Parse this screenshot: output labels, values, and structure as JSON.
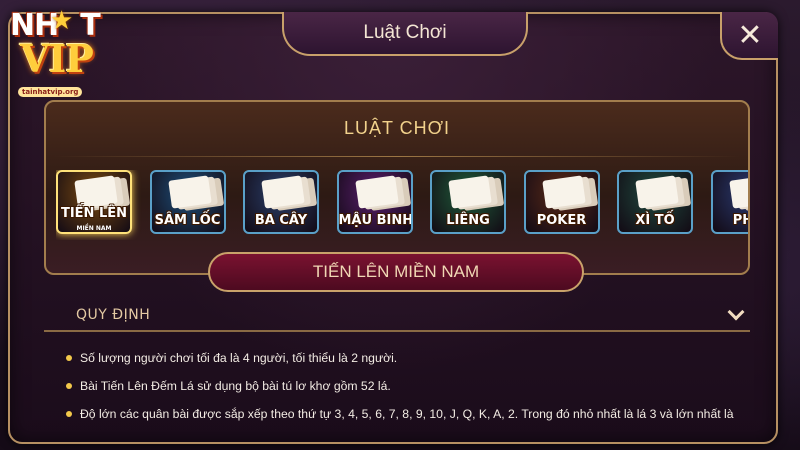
{
  "logo": {
    "line1": "NH",
    "star": "★",
    "line1_end": "T",
    "line2": "VIP",
    "site": "tainhatvip.org"
  },
  "dialog": {
    "title": "Luật Chơi",
    "close_label": "✕"
  },
  "panel": {
    "title": "LUẬT CHƠI"
  },
  "games": [
    {
      "label": "TIẾN LÊN",
      "sub": "MIỀN NAM",
      "bg": "#7a4a10",
      "active": true
    },
    {
      "label": "SÂM LỐC",
      "sub": "",
      "bg": "#1e4f7a",
      "active": false
    },
    {
      "label": "BA CÂY",
      "sub": "",
      "bg": "#2a3f6a",
      "active": false
    },
    {
      "label": "MẬU BINH",
      "sub": "",
      "bg": "#5a1e6e",
      "active": false
    },
    {
      "label": "LIÊNG",
      "sub": "",
      "bg": "#1f5c3a",
      "active": false
    },
    {
      "label": "POKER",
      "sub": "",
      "bg": "#5a2a18",
      "active": false
    },
    {
      "label": "XÌ TỐ",
      "sub": "",
      "bg": "#1f4a3e",
      "active": false
    },
    {
      "label": "PHỎ",
      "sub": "",
      "bg": "#2a3a70",
      "active": false
    }
  ],
  "selected_game": "TIẾN LÊN MIỀN NAM",
  "section": {
    "title": "QUY ĐỊNH"
  },
  "rules": [
    "Số lượng người chơi tối đa là 4 người, tối thiểu là 2 người.",
    "Bài Tiến Lên Đếm Lá sử dụng bộ bài tú lơ khơ gồm 52 lá.",
    "Độ lớn các quân bài được sắp xếp theo thứ tự 3, 4, 5, 6, 7, 8, 9, 10, J, Q, K, A, 2. Trong đó nhỏ nhất là lá 3 và lớn nhất là"
  ],
  "colors": {
    "gold_border": "#c8a06a",
    "panel_title": "#f2d28c",
    "banner": "#7a1230",
    "bullet": "#f2c84b"
  }
}
